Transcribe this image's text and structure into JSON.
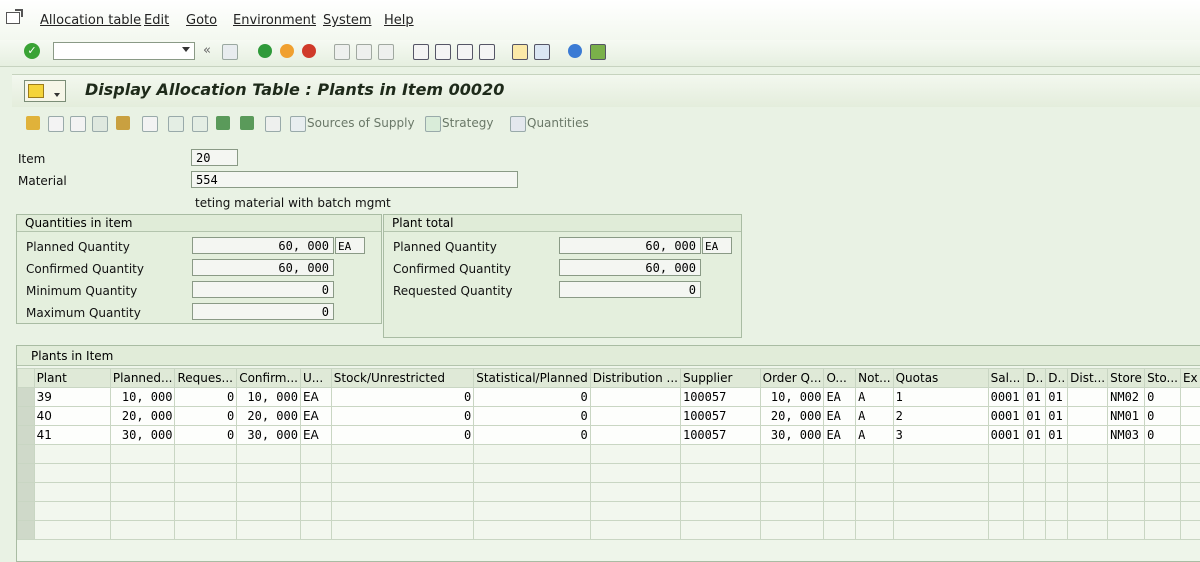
{
  "menu": [
    "Allocation table",
    "Edit",
    "Goto",
    "Environment",
    "System",
    "Help"
  ],
  "toolbar": {
    "command_value": "",
    "back_chevrons": "«"
  },
  "title": "Display Allocation Table : Plants in Item 00020",
  "app_toolbar": {
    "sources_of_supply": "Sources of Supply",
    "strategy": "Strategy",
    "quantities": "Quantities"
  },
  "header": {
    "item_label": "Item",
    "item_value": "20",
    "material_label": "Material",
    "material_value": "554",
    "material_desc": "teting material with batch mgmt"
  },
  "quantities_in_item": {
    "title": "Quantities in item",
    "rows": [
      {
        "label": "Planned Quantity",
        "value": "60, 000",
        "unit": "EA"
      },
      {
        "label": "Confirmed Quantity",
        "value": "60, 000",
        "unit": ""
      },
      {
        "label": "Minimum Quantity",
        "value": "0",
        "unit": ""
      },
      {
        "label": "Maximum Quantity",
        "value": "0",
        "unit": ""
      }
    ]
  },
  "plant_total": {
    "title": "Plant total",
    "rows": [
      {
        "label": "Planned Quantity",
        "value": "60, 000",
        "unit": "EA"
      },
      {
        "label": "Confirmed Quantity",
        "value": "60, 000",
        "unit": ""
      },
      {
        "label": "Requested Quantity",
        "value": "0",
        "unit": ""
      }
    ]
  },
  "table": {
    "caption": "Plants in Item",
    "columns": [
      "Plant",
      "Planned...",
      "Reques...",
      "Confirm...",
      "U...",
      "Stock/Unrestricted",
      "Statistical/Planned",
      "Distribution ...",
      "Supplier",
      "Order Q...",
      "O...",
      "Not...",
      "Quotas",
      "Sal...",
      "D..",
      "D..",
      "Dist...",
      "Store",
      "Sto...",
      "Ex"
    ],
    "rows": [
      [
        "39",
        "10, 000",
        "0",
        "10, 000",
        "EA",
        "0",
        "0",
        "",
        "100057",
        "10, 000",
        "EA",
        "A",
        "1",
        "0001",
        "01",
        "01",
        "",
        "NM02",
        "0",
        ""
      ],
      [
        "40",
        "20, 000",
        "0",
        "20, 000",
        "EA",
        "0",
        "0",
        "",
        "100057",
        "20, 000",
        "EA",
        "A",
        "2",
        "0001",
        "01",
        "01",
        "",
        "NM01",
        "0",
        ""
      ],
      [
        "41",
        "30, 000",
        "0",
        "30, 000",
        "EA",
        "0",
        "0",
        "",
        "100057",
        "30, 000",
        "EA",
        "A",
        "3",
        "0001",
        "01",
        "01",
        "",
        "NM03",
        "0",
        ""
      ]
    ]
  }
}
